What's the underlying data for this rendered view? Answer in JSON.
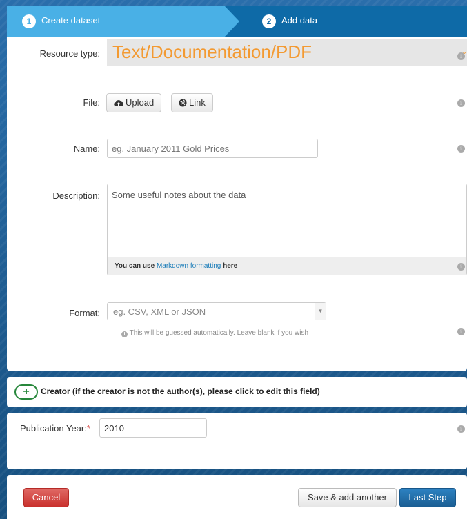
{
  "stages": {
    "step1": {
      "number": "1",
      "label": "Create dataset"
    },
    "step2": {
      "number": "2",
      "label": "Add data"
    }
  },
  "resource_type": {
    "label": "Resource type:",
    "value": "Text/Documentation/PDF"
  },
  "file": {
    "label": "File:",
    "upload_label": "Upload",
    "link_label": "Link"
  },
  "name": {
    "label": "Name:",
    "placeholder": "eg. January 2011 Gold Prices"
  },
  "description": {
    "label": "Description:",
    "placeholder": "Some useful notes about the data",
    "help_prefix": "You can use ",
    "help_link": "Markdown formatting",
    "help_suffix": " here"
  },
  "format": {
    "label": "Format:",
    "placeholder": "eg. CSV, XML or JSON",
    "help": "This will be guessed automatically. Leave blank if you wish"
  },
  "creator": {
    "toggle": "+",
    "label": "Creator (if the creator is not the author(s), please click to edit this field)"
  },
  "publication_year": {
    "label": "Publication Year:",
    "required_mark": "*",
    "value": "2010"
  },
  "actions": {
    "cancel": "Cancel",
    "save_add_another": "Save & add another",
    "last_step": "Last Step"
  },
  "icons": {
    "info": "info-circle-icon",
    "upload": "cloud-upload-icon",
    "link": "globe-icon",
    "add": "plus-circle-icon",
    "dropdown": "caret-down-icon"
  },
  "colors": {
    "stage_active": "#49b0e6",
    "stage_inactive": "#0e6aa7",
    "resource_type_text": "#f39a32",
    "primary": "#1b5e93",
    "danger": "#c9302c",
    "creator_green": "#27873b",
    "link": "#187bb8"
  }
}
